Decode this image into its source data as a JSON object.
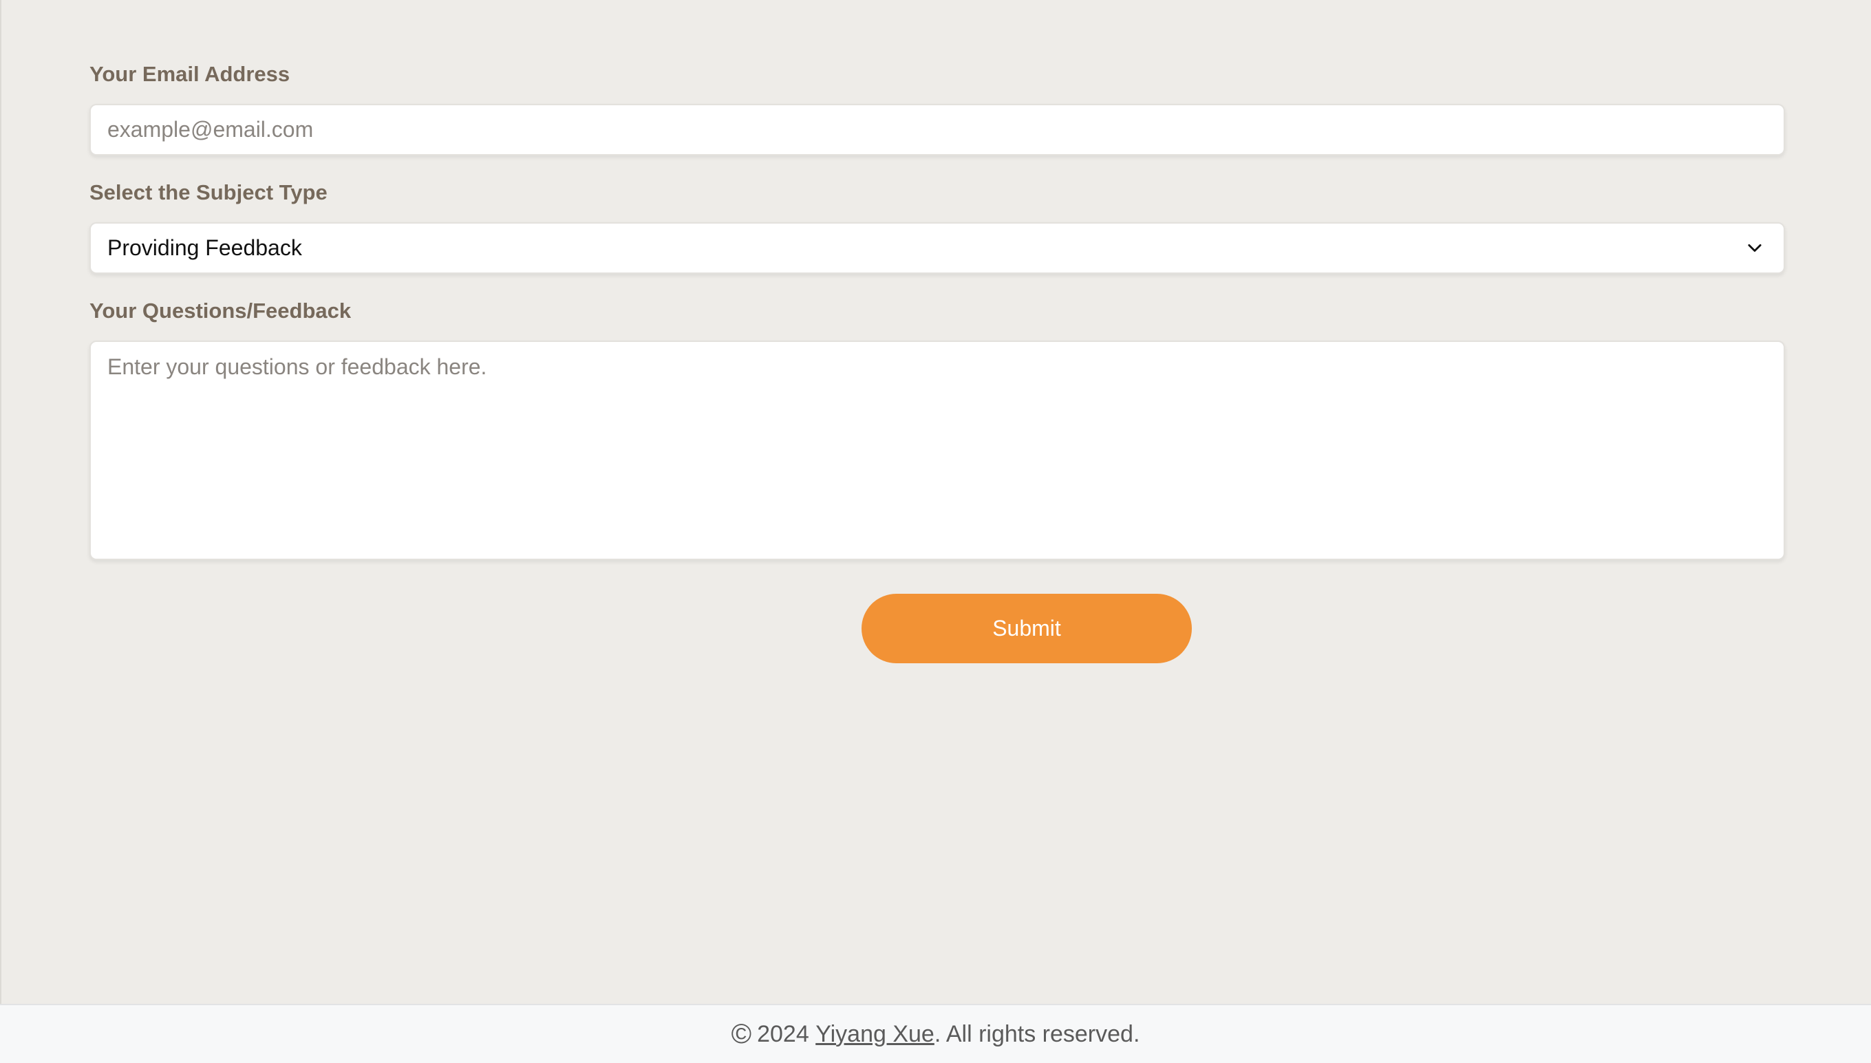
{
  "form": {
    "email_label": "Your Email Address",
    "email_placeholder": "example@email.com",
    "email_value": "",
    "subject_label": "Select the Subject Type",
    "subject_selected": "Providing Feedback",
    "feedback_label": "Your Questions/Feedback",
    "feedback_placeholder": "Enter your questions or feedback here.",
    "feedback_value": "",
    "submit_label": "Submit"
  },
  "footer": {
    "copyright_symbol": "©",
    "year_text": "2024",
    "author_link": "Yiyang Xue",
    "suffix": ". All rights reserved."
  },
  "colors": {
    "background": "#eeece8",
    "label": "#76695b",
    "accent": "#f29235"
  },
  "icons": {
    "select_chevron": "chevron-down-icon",
    "copyright": "copyright-icon"
  }
}
